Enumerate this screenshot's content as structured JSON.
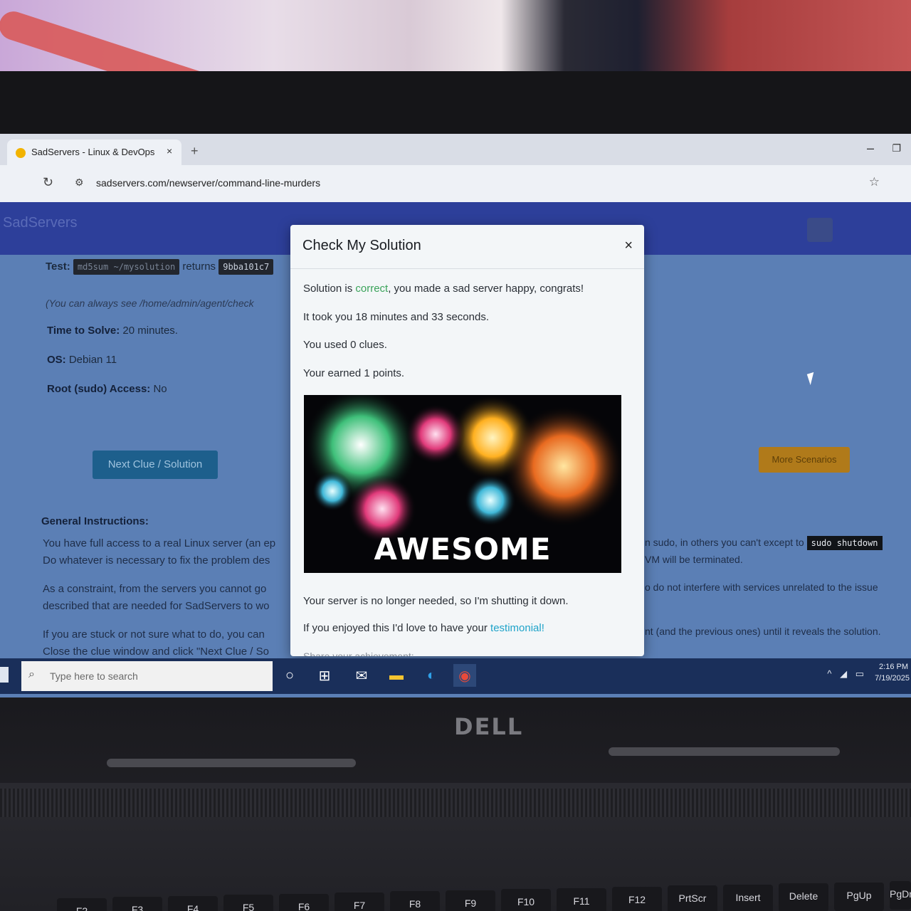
{
  "browser": {
    "tab_title": "SadServers - Linux & DevOps",
    "tab_close": "×",
    "new_tab": "+",
    "url": "sadservers.com/newserver/command-line-murders"
  },
  "page": {
    "brand": "SadServers",
    "test_label": "Test:",
    "test_command": "md5sum ~/mysolution",
    "test_returns": "returns",
    "test_hash": "9bba101c7",
    "note": "(You can always see /home/admin/agent/check",
    "time_label": "Time to Solve:",
    "time_value": "20 minutes.",
    "os_label": "OS:",
    "os_value": "Debian 11",
    "root_label": "Root (sudo) Access:",
    "root_value": "No",
    "next_clue_button": "Next Clue / Solution",
    "more_scenarios_button": "More Scenarios",
    "general_heading": "General Instructions:",
    "para1_line1": "You have full access to a real Linux server (an ep",
    "para1_line2": "Do whatever is necessary to fix the problem des",
    "para2_line1": "As a constraint, from the servers you cannot go",
    "para2_line2": "described that are needed for SadServers to wo",
    "para3_line1": "If you are stuck or not sure what to do, you can",
    "para3_line2": "Close the clue window and click \"Next Clue / So",
    "right1_a": "n sudo, in others you can't except to",
    "right1_code": "sudo shutdown",
    "right1_b": "VM will be terminated.",
    "right2": "o do not interfere with services unrelated to the issue",
    "right3": "nt (and the previous ones) until it reveals the solution."
  },
  "modal": {
    "title": "Check My Solution",
    "close": "×",
    "line1_a": "Solution is ",
    "line1_correct": "correct",
    "line1_b": ", you made a sad server happy, congrats!",
    "line2": "It took you 18 minutes and 33 seconds.",
    "line3": "You used 0 clues.",
    "line4": "Your earned 1 points.",
    "image_text": "AWESOME",
    "line5": "Your server is no longer needed, so I'm shutting it down.",
    "line6_a": "If you enjoyed this I'd love to have your ",
    "line6_link": "testimonial!",
    "line7": "Share your achievement:"
  },
  "taskbar": {
    "search_placeholder": "Type here to search",
    "time": "2:16 PM",
    "date": "7/19/2025"
  },
  "laptop": {
    "logo": "DELL",
    "keys": [
      "F2",
      "F3",
      "F4",
      "F5",
      "F6",
      "F7",
      "F8",
      "F9",
      "F10",
      "F11",
      "F12",
      "PrtScr",
      "Insert",
      "Delete",
      "PgUp",
      "PgDn"
    ]
  },
  "colors": {
    "navbar": "#2d3f9a",
    "correct": "#3aa35a",
    "link": "#1fa3c9",
    "next_button": "#1d5f8c",
    "more_button": "#b07a1a"
  }
}
